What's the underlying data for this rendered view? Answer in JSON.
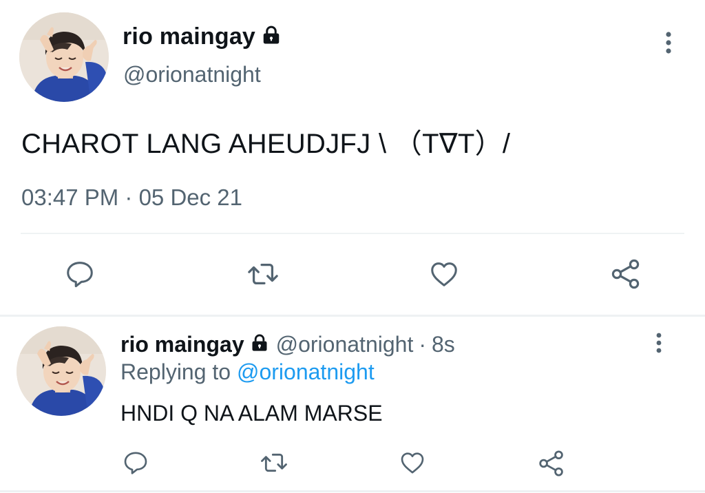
{
  "main_tweet": {
    "author_name": "rio maingay",
    "author_handle": "@orionatnight",
    "text": "CHAROT LANG AHEUDJFJ \\ （T∇T）/",
    "timestamp": "03:47 PM · 05 Dec 21",
    "icons": {
      "lock": "lock-icon",
      "more": "more-vertical-icon",
      "reply": "reply-icon",
      "retweet": "retweet-icon",
      "like": "heart-icon",
      "share": "share-icon"
    }
  },
  "reply_tweet": {
    "author_name": "rio maingay",
    "author_handle": "@orionatnight",
    "separator": "·",
    "time_ago": "8s",
    "replying_prefix": "Replying to ",
    "replying_to": "@orionatnight",
    "text": "HNDI Q NA ALAM MARSE"
  },
  "colors": {
    "primary_text": "#0f1419",
    "secondary_text": "#536471",
    "mention_blue": "#1d9bf0",
    "divider": "#eff3f4",
    "icon_gray": "#536471"
  }
}
